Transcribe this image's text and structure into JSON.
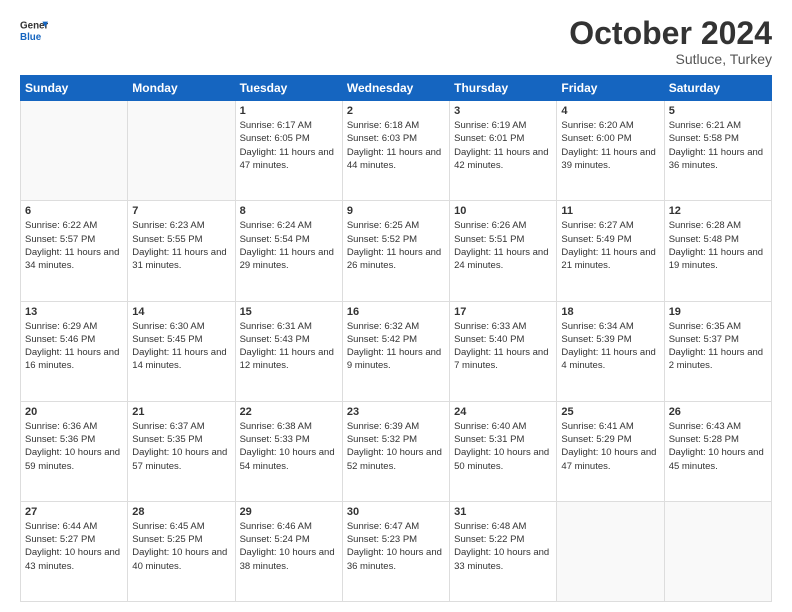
{
  "header": {
    "logo_general": "General",
    "logo_blue": "Blue",
    "month_title": "October 2024",
    "subtitle": "Sutluce, Turkey"
  },
  "weekdays": [
    "Sunday",
    "Monday",
    "Tuesday",
    "Wednesday",
    "Thursday",
    "Friday",
    "Saturday"
  ],
  "weeks": [
    [
      {
        "day": "",
        "sunrise": "",
        "sunset": "",
        "daylight": ""
      },
      {
        "day": "",
        "sunrise": "",
        "sunset": "",
        "daylight": ""
      },
      {
        "day": "1",
        "sunrise": "Sunrise: 6:17 AM",
        "sunset": "Sunset: 6:05 PM",
        "daylight": "Daylight: 11 hours and 47 minutes."
      },
      {
        "day": "2",
        "sunrise": "Sunrise: 6:18 AM",
        "sunset": "Sunset: 6:03 PM",
        "daylight": "Daylight: 11 hours and 44 minutes."
      },
      {
        "day": "3",
        "sunrise": "Sunrise: 6:19 AM",
        "sunset": "Sunset: 6:01 PM",
        "daylight": "Daylight: 11 hours and 42 minutes."
      },
      {
        "day": "4",
        "sunrise": "Sunrise: 6:20 AM",
        "sunset": "Sunset: 6:00 PM",
        "daylight": "Daylight: 11 hours and 39 minutes."
      },
      {
        "day": "5",
        "sunrise": "Sunrise: 6:21 AM",
        "sunset": "Sunset: 5:58 PM",
        "daylight": "Daylight: 11 hours and 36 minutes."
      }
    ],
    [
      {
        "day": "6",
        "sunrise": "Sunrise: 6:22 AM",
        "sunset": "Sunset: 5:57 PM",
        "daylight": "Daylight: 11 hours and 34 minutes."
      },
      {
        "day": "7",
        "sunrise": "Sunrise: 6:23 AM",
        "sunset": "Sunset: 5:55 PM",
        "daylight": "Daylight: 11 hours and 31 minutes."
      },
      {
        "day": "8",
        "sunrise": "Sunrise: 6:24 AM",
        "sunset": "Sunset: 5:54 PM",
        "daylight": "Daylight: 11 hours and 29 minutes."
      },
      {
        "day": "9",
        "sunrise": "Sunrise: 6:25 AM",
        "sunset": "Sunset: 5:52 PM",
        "daylight": "Daylight: 11 hours and 26 minutes."
      },
      {
        "day": "10",
        "sunrise": "Sunrise: 6:26 AM",
        "sunset": "Sunset: 5:51 PM",
        "daylight": "Daylight: 11 hours and 24 minutes."
      },
      {
        "day": "11",
        "sunrise": "Sunrise: 6:27 AM",
        "sunset": "Sunset: 5:49 PM",
        "daylight": "Daylight: 11 hours and 21 minutes."
      },
      {
        "day": "12",
        "sunrise": "Sunrise: 6:28 AM",
        "sunset": "Sunset: 5:48 PM",
        "daylight": "Daylight: 11 hours and 19 minutes."
      }
    ],
    [
      {
        "day": "13",
        "sunrise": "Sunrise: 6:29 AM",
        "sunset": "Sunset: 5:46 PM",
        "daylight": "Daylight: 11 hours and 16 minutes."
      },
      {
        "day": "14",
        "sunrise": "Sunrise: 6:30 AM",
        "sunset": "Sunset: 5:45 PM",
        "daylight": "Daylight: 11 hours and 14 minutes."
      },
      {
        "day": "15",
        "sunrise": "Sunrise: 6:31 AM",
        "sunset": "Sunset: 5:43 PM",
        "daylight": "Daylight: 11 hours and 12 minutes."
      },
      {
        "day": "16",
        "sunrise": "Sunrise: 6:32 AM",
        "sunset": "Sunset: 5:42 PM",
        "daylight": "Daylight: 11 hours and 9 minutes."
      },
      {
        "day": "17",
        "sunrise": "Sunrise: 6:33 AM",
        "sunset": "Sunset: 5:40 PM",
        "daylight": "Daylight: 11 hours and 7 minutes."
      },
      {
        "day": "18",
        "sunrise": "Sunrise: 6:34 AM",
        "sunset": "Sunset: 5:39 PM",
        "daylight": "Daylight: 11 hours and 4 minutes."
      },
      {
        "day": "19",
        "sunrise": "Sunrise: 6:35 AM",
        "sunset": "Sunset: 5:37 PM",
        "daylight": "Daylight: 11 hours and 2 minutes."
      }
    ],
    [
      {
        "day": "20",
        "sunrise": "Sunrise: 6:36 AM",
        "sunset": "Sunset: 5:36 PM",
        "daylight": "Daylight: 10 hours and 59 minutes."
      },
      {
        "day": "21",
        "sunrise": "Sunrise: 6:37 AM",
        "sunset": "Sunset: 5:35 PM",
        "daylight": "Daylight: 10 hours and 57 minutes."
      },
      {
        "day": "22",
        "sunrise": "Sunrise: 6:38 AM",
        "sunset": "Sunset: 5:33 PM",
        "daylight": "Daylight: 10 hours and 54 minutes."
      },
      {
        "day": "23",
        "sunrise": "Sunrise: 6:39 AM",
        "sunset": "Sunset: 5:32 PM",
        "daylight": "Daylight: 10 hours and 52 minutes."
      },
      {
        "day": "24",
        "sunrise": "Sunrise: 6:40 AM",
        "sunset": "Sunset: 5:31 PM",
        "daylight": "Daylight: 10 hours and 50 minutes."
      },
      {
        "day": "25",
        "sunrise": "Sunrise: 6:41 AM",
        "sunset": "Sunset: 5:29 PM",
        "daylight": "Daylight: 10 hours and 47 minutes."
      },
      {
        "day": "26",
        "sunrise": "Sunrise: 6:43 AM",
        "sunset": "Sunset: 5:28 PM",
        "daylight": "Daylight: 10 hours and 45 minutes."
      }
    ],
    [
      {
        "day": "27",
        "sunrise": "Sunrise: 6:44 AM",
        "sunset": "Sunset: 5:27 PM",
        "daylight": "Daylight: 10 hours and 43 minutes."
      },
      {
        "day": "28",
        "sunrise": "Sunrise: 6:45 AM",
        "sunset": "Sunset: 5:25 PM",
        "daylight": "Daylight: 10 hours and 40 minutes."
      },
      {
        "day": "29",
        "sunrise": "Sunrise: 6:46 AM",
        "sunset": "Sunset: 5:24 PM",
        "daylight": "Daylight: 10 hours and 38 minutes."
      },
      {
        "day": "30",
        "sunrise": "Sunrise: 6:47 AM",
        "sunset": "Sunset: 5:23 PM",
        "daylight": "Daylight: 10 hours and 36 minutes."
      },
      {
        "day": "31",
        "sunrise": "Sunrise: 6:48 AM",
        "sunset": "Sunset: 5:22 PM",
        "daylight": "Daylight: 10 hours and 33 minutes."
      },
      {
        "day": "",
        "sunrise": "",
        "sunset": "",
        "daylight": ""
      },
      {
        "day": "",
        "sunrise": "",
        "sunset": "",
        "daylight": ""
      }
    ]
  ]
}
